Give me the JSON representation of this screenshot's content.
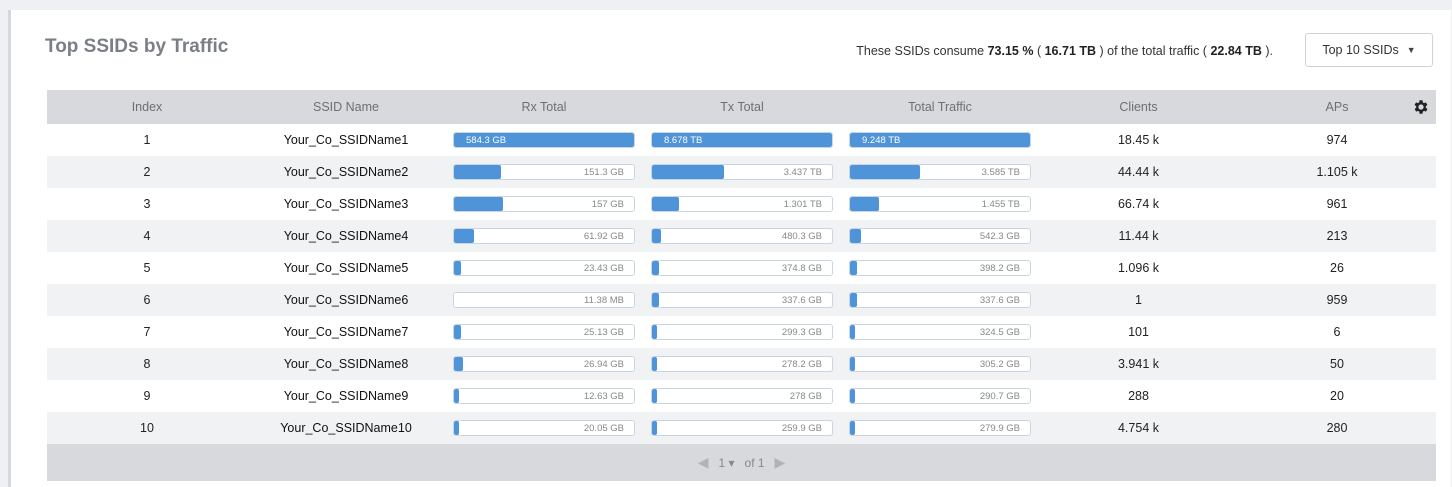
{
  "widget": {
    "title": "Top SSIDs by Traffic",
    "summary": {
      "prefix": "These SSIDs consume",
      "percent": "73.15 %",
      "mid1": "(",
      "ssid_traffic": "16.71 TB",
      "mid2": ") of the total traffic (",
      "total_traffic": "22.84 TB",
      "suffix": ")."
    },
    "top_n_select": {
      "value": "Top 10 SSIDs"
    }
  },
  "table": {
    "columns": [
      "Index",
      "SSID Name",
      "Rx Total",
      "Tx Total",
      "Total Traffic",
      "Clients",
      "APs"
    ],
    "rows": [
      {
        "index": "1",
        "name": "Your_Co_SSIDName1",
        "rx": "584.3 GB",
        "rx_pct": 100,
        "tx": "8.678 TB",
        "tx_pct": 100,
        "total": "9.248 TB",
        "total_pct": 100,
        "clients": "18.45 k",
        "aps": "974"
      },
      {
        "index": "2",
        "name": "Your_Co_SSIDName2",
        "rx": "151.3 GB",
        "rx_pct": 26,
        "tx": "3.437 TB",
        "tx_pct": 40,
        "total": "3.585 TB",
        "total_pct": 39,
        "clients": "44.44 k",
        "aps": "1.105 k"
      },
      {
        "index": "3",
        "name": "Your_Co_SSIDName3",
        "rx": "157 GB",
        "rx_pct": 27,
        "tx": "1.301 TB",
        "tx_pct": 15,
        "total": "1.455 TB",
        "total_pct": 16,
        "clients": "66.74 k",
        "aps": "961"
      },
      {
        "index": "4",
        "name": "Your_Co_SSIDName4",
        "rx": "61.92 GB",
        "rx_pct": 11,
        "tx": "480.3 GB",
        "tx_pct": 5,
        "total": "542.3 GB",
        "total_pct": 6,
        "clients": "11.44 k",
        "aps": "213"
      },
      {
        "index": "5",
        "name": "Your_Co_SSIDName5",
        "rx": "23.43 GB",
        "rx_pct": 4,
        "tx": "374.8 GB",
        "tx_pct": 4,
        "total": "398.2 GB",
        "total_pct": 4,
        "clients": "1.096 k",
        "aps": "26"
      },
      {
        "index": "6",
        "name": "Your_Co_SSIDName6",
        "rx": "11.38 MB",
        "rx_pct": 0,
        "tx": "337.6 GB",
        "tx_pct": 4,
        "total": "337.6 GB",
        "total_pct": 4,
        "clients": "1",
        "aps": "959"
      },
      {
        "index": "7",
        "name": "Your_Co_SSIDName7",
        "rx": "25.13 GB",
        "rx_pct": 4,
        "tx": "299.3 GB",
        "tx_pct": 3,
        "total": "324.5 GB",
        "total_pct": 3,
        "clients": "101",
        "aps": "6"
      },
      {
        "index": "8",
        "name": "Your_Co_SSIDName8",
        "rx": "26.94 GB",
        "rx_pct": 5,
        "tx": "278.2 GB",
        "tx_pct": 3,
        "total": "305.2 GB",
        "total_pct": 3,
        "clients": "3.941 k",
        "aps": "50"
      },
      {
        "index": "9",
        "name": "Your_Co_SSIDName9",
        "rx": "12.63 GB",
        "rx_pct": 2,
        "tx": "278 GB",
        "tx_pct": 3,
        "total": "290.7 GB",
        "total_pct": 3,
        "clients": "288",
        "aps": "20"
      },
      {
        "index": "10",
        "name": "Your_Co_SSIDName10",
        "rx": "20.05 GB",
        "rx_pct": 3,
        "tx": "259.9 GB",
        "tx_pct": 3,
        "total": "279.9 GB",
        "total_pct": 3,
        "clients": "4.754 k",
        "aps": "280"
      }
    ]
  },
  "pager": {
    "page": "1",
    "of_label": "of 1"
  },
  "colors": {
    "bar_fill": "#4f93d8",
    "header_bg": "#d7d9dc"
  },
  "icons": {
    "settings": "gear-icon",
    "prev": "arrow-left-icon",
    "next": "arrow-right-icon",
    "dropdown": "caret-down-icon"
  }
}
